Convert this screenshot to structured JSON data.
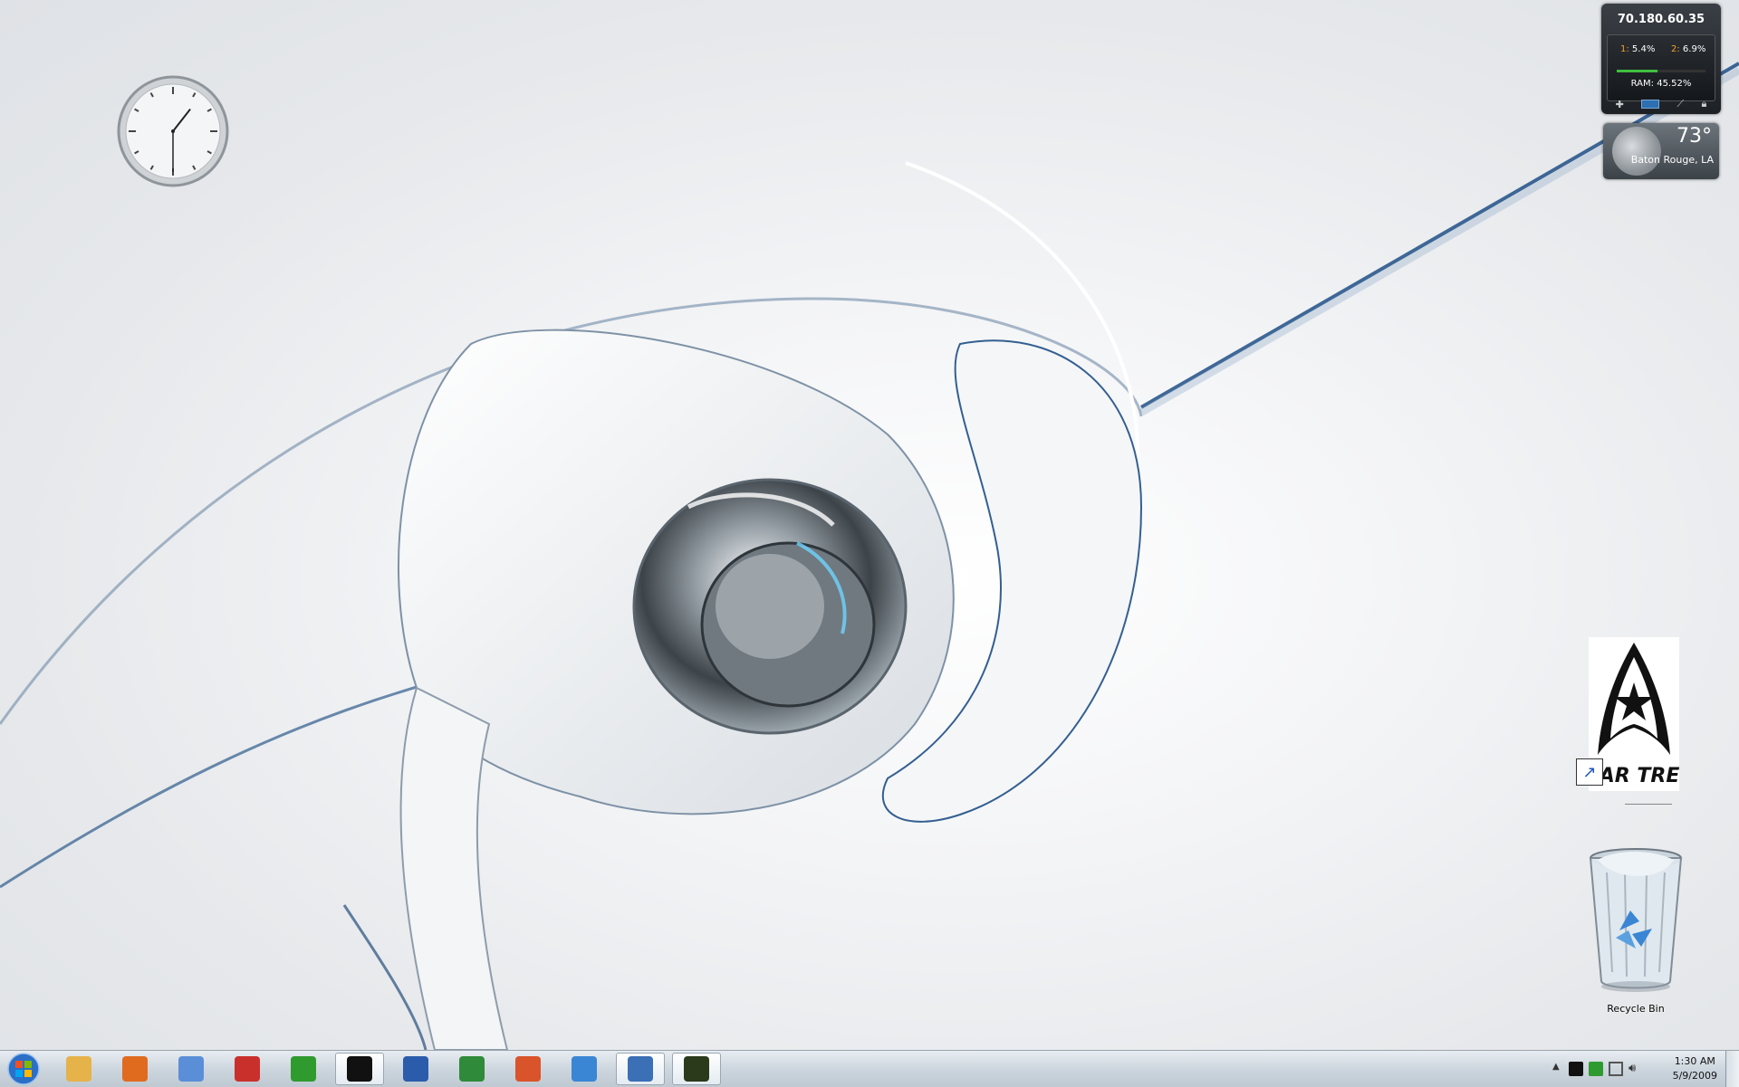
{
  "gadgets": {
    "cpu_meter": {
      "ip": "70.180.60.35",
      "core1_label": "1:",
      "core1_value": "5.4%",
      "core2_label": "2:",
      "core2_value": "6.9%",
      "ram_text": "RAM: 45.52%",
      "ram_fraction": 0.4552,
      "icons": [
        "plus-icon",
        "monitor-icon",
        "wrench-icon",
        "lock-icon"
      ]
    },
    "weather": {
      "temperature": "73°",
      "city": "Baton Rouge, LA"
    },
    "clock": {
      "hour_angle_deg": 38,
      "minute_angle_deg": 180
    }
  },
  "desktop_icons": {
    "startrek": {
      "logo_text": "STAR TREK"
    },
    "recycle_bin": {
      "label": "Recycle Bin"
    }
  },
  "taskbar": {
    "start_icon": "windows-logo-icon",
    "items": [
      {
        "name": "explorer",
        "icon": "folder-icon",
        "color": "#e6b24a",
        "active": false
      },
      {
        "name": "firefox",
        "icon": "firefox-icon",
        "color": "#e06b1f",
        "active": false
      },
      {
        "name": "itunes",
        "icon": "music-icon",
        "color": "#5a8fd8",
        "active": false
      },
      {
        "name": "gadget",
        "icon": "red-orb-icon",
        "color": "#c9302c",
        "active": false
      },
      {
        "name": "utorrent",
        "icon": "mu-icon",
        "color": "#2f9b2f",
        "active": false
      },
      {
        "name": "steam",
        "icon": "steam-icon",
        "color": "#111111",
        "active": true
      },
      {
        "name": "word",
        "icon": "word-icon",
        "color": "#2b5cab",
        "active": false
      },
      {
        "name": "excel",
        "icon": "excel-icon",
        "color": "#2f8a3a",
        "active": false
      },
      {
        "name": "powerpoint",
        "icon": "powerpoint-icon",
        "color": "#d9542a",
        "active": false
      },
      {
        "name": "flight",
        "icon": "plane-icon",
        "color": "#3a86d4",
        "active": false
      },
      {
        "name": "remote",
        "icon": "network-pc-icon",
        "color": "#3b6fb6",
        "active": true
      },
      {
        "name": "game",
        "icon": "game-icon",
        "color": "#2c3a1c",
        "active": true
      }
    ],
    "tray": {
      "icons": [
        "steam-tray-icon",
        "utorrent-tray-icon",
        "network-icon",
        "volume-icon"
      ],
      "time": "1:30 AM",
      "date": "5/9/2009"
    }
  }
}
